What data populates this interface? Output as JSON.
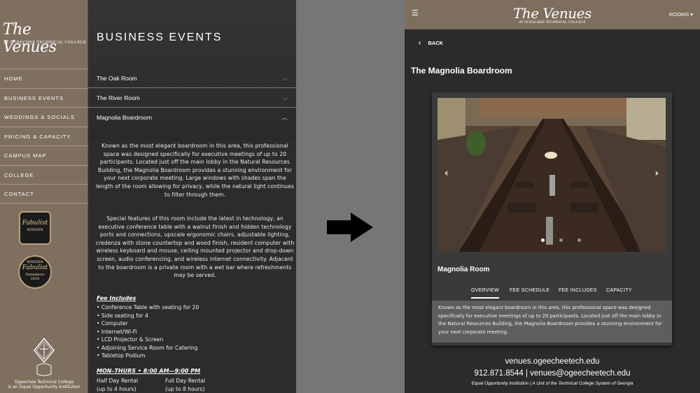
{
  "left": {
    "logo_script": "The Venues",
    "logo_sub": "AT OGEECHEE TECHNICAL COLLEGE",
    "nav": [
      "HOME",
      "BUSINESS EVENTS",
      "WEDDINGS & SOCIALS",
      "PRICING & CAPACITY",
      "CAMPUS MAP",
      "COLLEGE",
      "CONTACT"
    ],
    "badge1": {
      "script": "Fabulist",
      "label": "WINNER"
    },
    "badge2": {
      "top": "WINNER",
      "script": "Fabulist",
      "label": "Statesboro",
      "year": "2019"
    },
    "crest_label_1": "Ogeechee Technical College",
    "crest_label_2": "is an Equal Opportunity Institution",
    "page_title": "BUSINESS EVENTS",
    "accordion": [
      {
        "label": "The Oak Room",
        "icon": "chevron-down-icon",
        "chevron": "⌵"
      },
      {
        "label": "The River Room",
        "icon": "chevron-down-icon",
        "chevron": "⌵"
      },
      {
        "label": "Magnolia Boardroom",
        "icon": "chevron-up-icon",
        "chevron": "︿"
      }
    ],
    "para1": "Known as the most elegant boardroom in this area, this professional space was designed specifically for executive meetings of up to 20 participants. Located just off the main lobby in the Natural Resources Building, the Magnolia Boardroom provides a stunning environment for your next corporate meeting. Large windows with shades span the length of the room allowing for privacy, while the natural light continues to filter through them.",
    "para2": "Special features of this room include the latest in technology, an executive conference table with a walnut finish and hidden technology ports and connections, upscale ergonomic chairs, adjustable lighting, credenza with stone countertop and wood finish, resident computer with wireless keyboard and mouse, ceiling mounted projector and drop-down screen, audio conferencing, and wireless internet connectivity. Adjacent to the boardroom is a private room with a wet bar where refreshments may be served.",
    "fee_head": "Fee Includes",
    "fees": [
      "• Conference Table with seating for 20",
      "• Side seating for 4",
      "• Computer",
      "• Internet/Wi-Fi",
      "• LCD Projector & Screen",
      "• Adjoining Service Room for Catering",
      "• Tabletop Podium"
    ],
    "mon_head": "MON–THURS • 8:00 AM—9:00 PM",
    "half_day": "Half Day Rental",
    "half_day_sub": "(up to 4 hours)",
    "full_day": "Full Day Rental",
    "full_day_sub": "(up to 8 hours)"
  },
  "right": {
    "logo_script": "The Venues",
    "logo_sub": "AT OGEECHEE TECHNICAL COLLEGE",
    "menu_icon": "☰",
    "rooms_label": "ROOMS ▾",
    "back_label": "BACK",
    "back_icon": "‹",
    "room_title": "The Magnolia Boardroom",
    "prev_icon": "‹",
    "next_icon": "›",
    "card_name": "Magnolia Room",
    "tabs": [
      "OVERVIEW",
      "FEE SCHEDULE",
      "FEE INCLUDES",
      "CAPACITY"
    ],
    "description": "Known as the most elegant boardroom in this area, this professional space was designed specifically for executive meetings of up to 20 participants. Located just off the main lobby in the Natural Resources Building, the Magnolia Boardroom provides a stunning environment for your next corporate meeting.",
    "footer_web": "venues.ogeecheetech.edu",
    "footer_phone": "912.871.8544 | venues@ogeecheetech.edu",
    "footer_eo": "Equal Opportunity Institution | A Unit of the Technical College System of Georgia"
  },
  "colors": {
    "brand_tan": "#7d6e5d",
    "dark_bg": "#2b2b2b"
  }
}
